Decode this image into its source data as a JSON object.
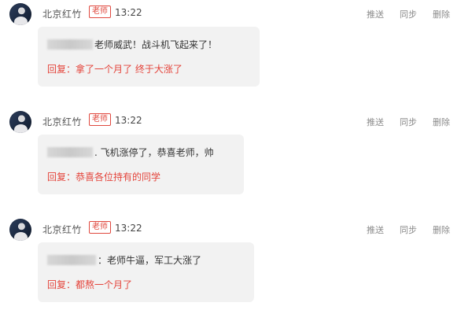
{
  "posts": [
    {
      "author": "北京红竹",
      "badge": "老师",
      "time": "13:22",
      "actions": {
        "push": "推送",
        "sync": "同步",
        "delete": "删除"
      },
      "comment_text": "老师威武！战斗机飞起来了！",
      "reply_label": "回复：",
      "reply_text": "拿了一个月了 终于大涨了"
    },
    {
      "author": "北京红竹",
      "badge": "老师",
      "time": "13:22",
      "actions": {
        "push": "推送",
        "sync": "同步",
        "delete": "删除"
      },
      "comment_text": ". 飞机涨停了，恭喜老师，帅",
      "reply_label": "回复：",
      "reply_text": "恭喜各位持有的同学"
    },
    {
      "author": "北京红竹",
      "badge": "老师",
      "time": "13:22",
      "actions": {
        "push": "推送",
        "sync": "同步",
        "delete": "删除"
      },
      "comment_text": "：老师牛逼，军工大涨了",
      "reply_label": "回复：",
      "reply_text": "都熬一个月了"
    }
  ],
  "colors": {
    "accent_red": "#e4443b",
    "bubble_bg": "#f2f2f2",
    "action_gray": "#8a8a8a"
  }
}
